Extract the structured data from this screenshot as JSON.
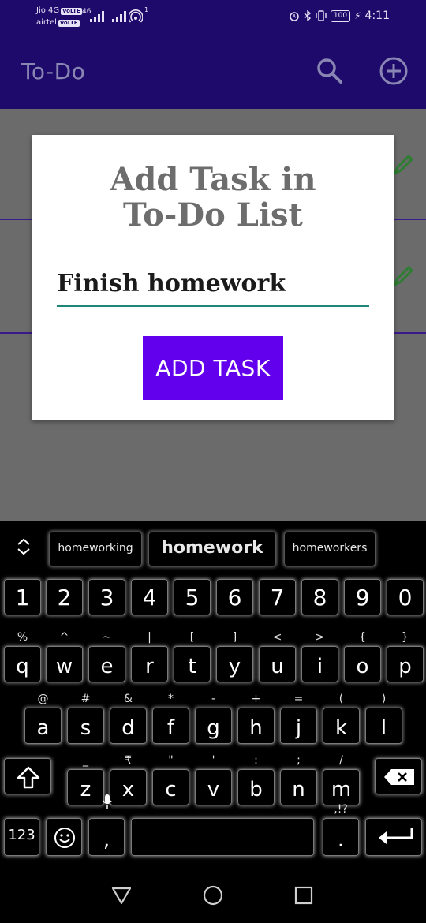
{
  "statusbar": {
    "carrier1": "Jio 4G",
    "carrier2": "airtel",
    "volte": "VoLTE",
    "net": "46",
    "wifi_sup": "1",
    "battery": "100",
    "time": "4:11"
  },
  "appbar": {
    "title": "To-Do",
    "search_icon": "search-icon",
    "add_icon": "add-circle-icon"
  },
  "dialog": {
    "title": "Add Task in\nTo-Do List",
    "input_value": "Finish homework",
    "button_label": "ADD TASK"
  },
  "keyboard": {
    "suggestions": [
      "homeworking",
      "homework",
      "homeworkers"
    ],
    "numbers": [
      "1",
      "2",
      "3",
      "4",
      "5",
      "6",
      "7",
      "8",
      "9",
      "0"
    ],
    "row1": [
      {
        "alt": "%",
        "main": "q"
      },
      {
        "alt": "^",
        "main": "w"
      },
      {
        "alt": "~",
        "main": "e"
      },
      {
        "alt": "|",
        "main": "r"
      },
      {
        "alt": "[",
        "main": "t"
      },
      {
        "alt": "]",
        "main": "y"
      },
      {
        "alt": "<",
        "main": "u"
      },
      {
        "alt": ">",
        "main": "i"
      },
      {
        "alt": "{",
        "main": "o"
      },
      {
        "alt": "}",
        "main": "p"
      }
    ],
    "row2": [
      {
        "alt": "@",
        "main": "a"
      },
      {
        "alt": "#",
        "main": "s"
      },
      {
        "alt": "&",
        "main": "d"
      },
      {
        "alt": "*",
        "main": "f"
      },
      {
        "alt": "-",
        "main": "g"
      },
      {
        "alt": "+",
        "main": "h"
      },
      {
        "alt": "=",
        "main": "j"
      },
      {
        "alt": "(",
        "main": "k"
      },
      {
        "alt": ")",
        "main": "l"
      }
    ],
    "row3": [
      {
        "alt": "_",
        "main": "z"
      },
      {
        "alt": "₹",
        "main": "x"
      },
      {
        "alt": "\"",
        "main": "c"
      },
      {
        "alt": "'",
        "main": "v"
      },
      {
        "alt": ":",
        "main": "b"
      },
      {
        "alt": ";",
        "main": "n"
      },
      {
        "alt": "/",
        "main": "m"
      }
    ],
    "numbers_label": "123",
    "comma": ",",
    "period": ".",
    "period_alt": ",!?"
  }
}
